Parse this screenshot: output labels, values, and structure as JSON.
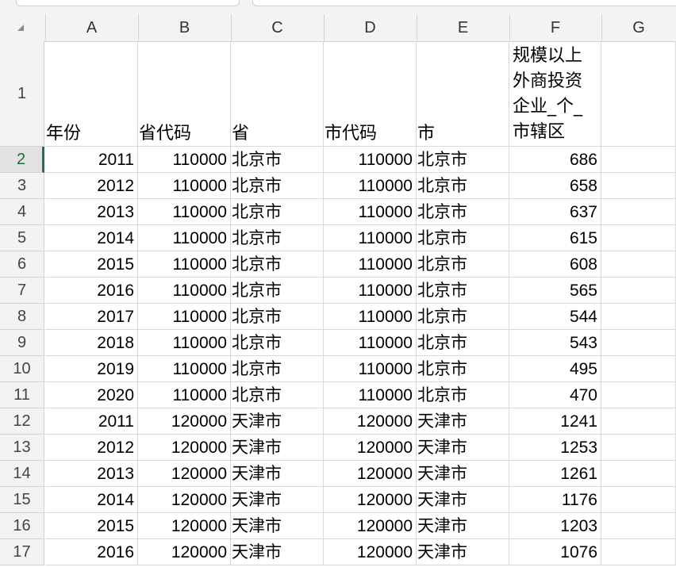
{
  "columns": [
    "A",
    "B",
    "C",
    "D",
    "E",
    "F",
    "G"
  ],
  "header_row": {
    "row_number": "1",
    "cells": [
      "年份",
      "省代码",
      "省",
      "市代码",
      "市",
      "规模以上外商投资企业_个_市辖区",
      ""
    ]
  },
  "rows": [
    {
      "n": "2",
      "year": "2011",
      "prov_code": "110000",
      "prov": "北京市",
      "city_code": "110000",
      "city": "北京市",
      "value": "686"
    },
    {
      "n": "3",
      "year": "2012",
      "prov_code": "110000",
      "prov": "北京市",
      "city_code": "110000",
      "city": "北京市",
      "value": "658"
    },
    {
      "n": "4",
      "year": "2013",
      "prov_code": "110000",
      "prov": "北京市",
      "city_code": "110000",
      "city": "北京市",
      "value": "637"
    },
    {
      "n": "5",
      "year": "2014",
      "prov_code": "110000",
      "prov": "北京市",
      "city_code": "110000",
      "city": "北京市",
      "value": "615"
    },
    {
      "n": "6",
      "year": "2015",
      "prov_code": "110000",
      "prov": "北京市",
      "city_code": "110000",
      "city": "北京市",
      "value": "608"
    },
    {
      "n": "7",
      "year": "2016",
      "prov_code": "110000",
      "prov": "北京市",
      "city_code": "110000",
      "city": "北京市",
      "value": "565"
    },
    {
      "n": "8",
      "year": "2017",
      "prov_code": "110000",
      "prov": "北京市",
      "city_code": "110000",
      "city": "北京市",
      "value": "544"
    },
    {
      "n": "9",
      "year": "2018",
      "prov_code": "110000",
      "prov": "北京市",
      "city_code": "110000",
      "city": "北京市",
      "value": "543"
    },
    {
      "n": "10",
      "year": "2019",
      "prov_code": "110000",
      "prov": "北京市",
      "city_code": "110000",
      "city": "北京市",
      "value": "495"
    },
    {
      "n": "11",
      "year": "2020",
      "prov_code": "110000",
      "prov": "北京市",
      "city_code": "110000",
      "city": "北京市",
      "value": "470"
    },
    {
      "n": "12",
      "year": "2011",
      "prov_code": "120000",
      "prov": "天津市",
      "city_code": "120000",
      "city": "天津市",
      "value": "1241"
    },
    {
      "n": "13",
      "year": "2012",
      "prov_code": "120000",
      "prov": "天津市",
      "city_code": "120000",
      "city": "天津市",
      "value": "1253"
    },
    {
      "n": "14",
      "year": "2013",
      "prov_code": "120000",
      "prov": "天津市",
      "city_code": "120000",
      "city": "天津市",
      "value": "1261"
    },
    {
      "n": "15",
      "year": "2014",
      "prov_code": "120000",
      "prov": "天津市",
      "city_code": "120000",
      "city": "天津市",
      "value": "1176"
    },
    {
      "n": "16",
      "year": "2015",
      "prov_code": "120000",
      "prov": "天津市",
      "city_code": "120000",
      "city": "天津市",
      "value": "1203"
    },
    {
      "n": "17",
      "year": "2016",
      "prov_code": "120000",
      "prov": "天津市",
      "city_code": "120000",
      "city": "天津市",
      "value": "1076"
    }
  ],
  "selected_row": "2"
}
